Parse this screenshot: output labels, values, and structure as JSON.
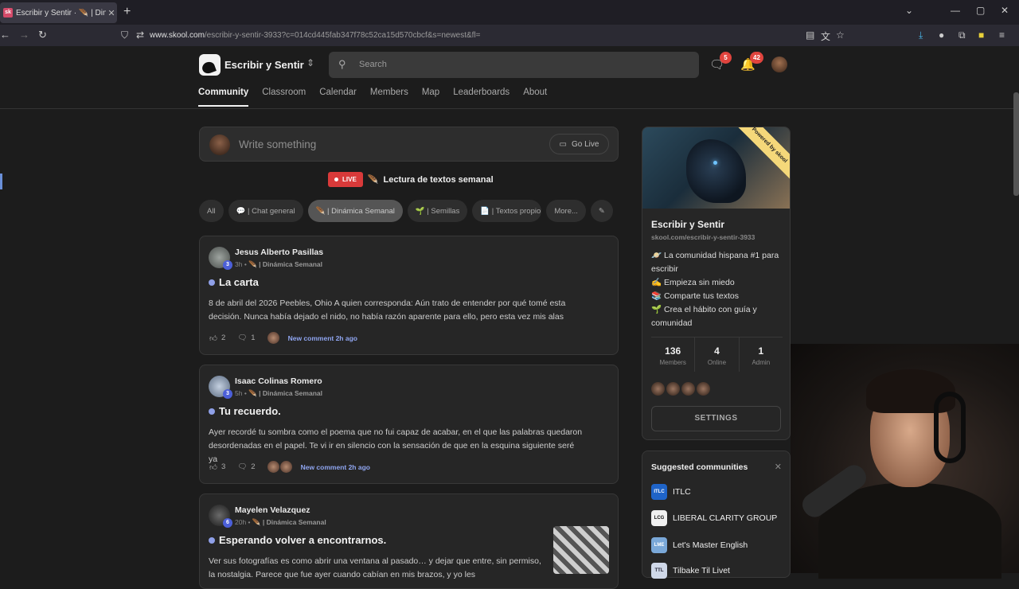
{
  "browser": {
    "tab_title": "Escribir y Sentir · 🪶 | Dinámica",
    "tab_favicon": "sk",
    "url_host": "www.skool.com",
    "url_path": "/escribir-y-sentir-3933?c=014cd445fab347f78c52ca15d570cbcf&s=newest&fl="
  },
  "header": {
    "community_name": "Escribir y Sentir",
    "search_placeholder": "Search",
    "chat_badge": "5",
    "notif_badge": "42"
  },
  "nav": [
    "Community",
    "Classroom",
    "Calendar",
    "Members",
    "Map",
    "Leaderboards",
    "About"
  ],
  "compose": {
    "placeholder": "Write something",
    "go_live": "Go Live"
  },
  "live": {
    "badge": "LIVE",
    "title": "Lectura de textos semanal"
  },
  "chips": [
    "All",
    "💬 | Chat general",
    "🪶 | Dinámica Semanal",
    "🌱 | Semillas",
    "📄 | Textos propio",
    "More...",
    "✎"
  ],
  "posts": [
    {
      "author": "Jesus Alberto Pasillas",
      "level": "3",
      "time": "3h",
      "category": "🪶 | Dinámica Semanal",
      "title": "La carta",
      "body": "8 de abril del 2026 Peebles, Ohio A quien corresponda: Aún trato de entender por qué tomé esta decisión. Nunca había dejado el nido, no había razón aparente para ello, pero esta vez mis alas",
      "likes": "2",
      "comments": "1",
      "new_comment": "New comment 2h ago"
    },
    {
      "author": "Isaac Colinas Romero",
      "level": "3",
      "time": "5h",
      "category": "🪶 | Dinámica Semanal",
      "title": "Tu recuerdo.",
      "body": "Ayer recordé tu sombra como el poema que no fui capaz de acabar, en el que las palabras quedaron desordenadas en el papel. Te vi ir en silencio con la sensación de que en la esquina siguiente seré ya",
      "likes": "3",
      "comments": "2",
      "new_comment": "New comment 2h ago"
    },
    {
      "author": "Mayelen Velazquez",
      "level": "6",
      "time": "20h",
      "category": "🪶 | Dinámica Semanal",
      "title": "Esperando volver a encontrarnos.",
      "body": "Ver sus fotografías es como abrir una ventana al pasado… y dejar que entre, sin permiso, la nostalgia. Parece que fue ayer cuando cabían en mis brazos, y yo les"
    }
  ],
  "sidebar": {
    "ribbon": "Powered by skool",
    "title": "Escribir y Sentir",
    "url": "skool.com/escribir-y-sentir-3933",
    "desc": [
      "🪐 La comunidad hispana #1 para escribir",
      "✍️ Empieza sin miedo",
      "📚 Comparte tus textos",
      "🌱 Crea el hábito con guía y comunidad"
    ],
    "stats": [
      {
        "n": "136",
        "l": "Members"
      },
      {
        "n": "4",
        "l": "Online"
      },
      {
        "n": "1",
        "l": "Admin"
      }
    ],
    "settings": "SETTINGS"
  },
  "suggested": {
    "title": "Suggested communities",
    "items": [
      {
        "name": "ITLC",
        "color": "#1f64c8",
        "icon": "ITLC"
      },
      {
        "name": "LIBERAL CLARITY GROUP",
        "color": "#f0f0f0",
        "icon": "LCG"
      },
      {
        "name": "Let's Master English",
        "color": "#7aa8d8",
        "icon": "LME"
      },
      {
        "name": "Tilbake Til Livet",
        "color": "#cfd8e8",
        "icon": "TTL"
      }
    ]
  }
}
